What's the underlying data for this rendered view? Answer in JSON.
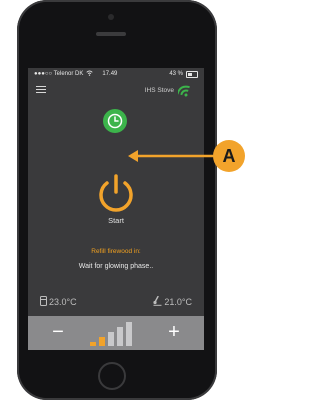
{
  "status_bar": {
    "carrier": "●●●○○ Telenor DK",
    "time": "17.49",
    "battery": "43 %"
  },
  "header": {
    "device_name": "IHS Stove"
  },
  "main": {
    "start_label": "Start",
    "refill_label": "Refill firewood in:",
    "status_message": "Wait for glowing phase..",
    "temp_left": "23.0°C",
    "temp_right": "21.0°C"
  },
  "controls": {
    "minus_label": "−",
    "plus_label": "+",
    "level_active": 2,
    "level_total": 5
  },
  "annotation": {
    "label": "A"
  },
  "colors": {
    "accent": "#f2a32b",
    "timer_green": "#3cb44b",
    "wifi_green": "#3cb44b"
  }
}
